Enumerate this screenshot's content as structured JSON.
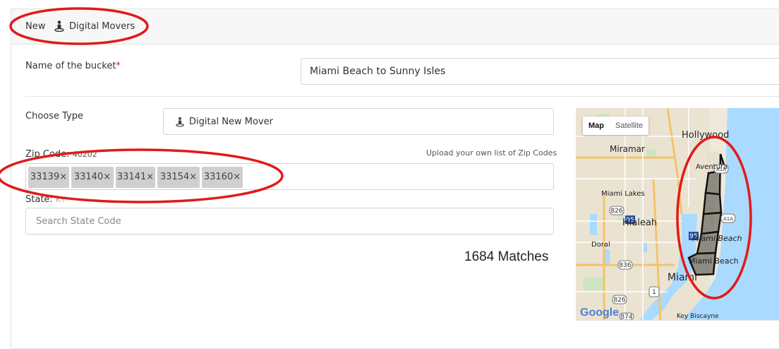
{
  "header": {
    "new_label": "New",
    "title": "Digital Movers",
    "icon": "person-pin-icon"
  },
  "form": {
    "bucket_name_label": "Name of the bucket",
    "bucket_name_required": "*",
    "bucket_name_value": "Miami Beach to Sunny Isles",
    "choose_type_label": "Choose Type",
    "choose_type_value": "Digital New Mover",
    "zip_label": "Zip Code:",
    "zip_hint": "40202",
    "upload_link": "Upload your own list of Zip Codes",
    "zip_tags": [
      {
        "code": "33139",
        "remove": "×"
      },
      {
        "code": "33140",
        "remove": "×"
      },
      {
        "code": "33141",
        "remove": "×"
      },
      {
        "code": "33154",
        "remove": "×"
      },
      {
        "code": "33160",
        "remove": "×"
      }
    ],
    "state_label": "State:",
    "state_hint": "KY",
    "state_placeholder": "Search State Code"
  },
  "results": {
    "matches_text": "1684 Matches"
  },
  "map": {
    "map_toggle": "Map",
    "satellite_toggle": "Satellite",
    "places": {
      "hollywood": "Hollywood",
      "miramar": "Miramar",
      "aventura": "Aventura",
      "miami_lakes": "Miami Lakes",
      "hialeah": "Hialeah",
      "doral": "Doral",
      "miami_beach_1": "Miami Beach",
      "miami_beach_2": "Miami Beach",
      "miami": "Miami",
      "key_biscayne": "Key Biscayne"
    },
    "route_826a": "826",
    "route_826b": "826",
    "route_836": "836",
    "route_826c": "826",
    "route_874": "874",
    "route_1": "1",
    "route_95": "95",
    "route_a1a_1": "A1A",
    "route_a1a_2": "A1A",
    "google": "Google",
    "water_color": "#aadaff",
    "land_color": "#efe9dc"
  },
  "annotation_color": "#e01a1a"
}
